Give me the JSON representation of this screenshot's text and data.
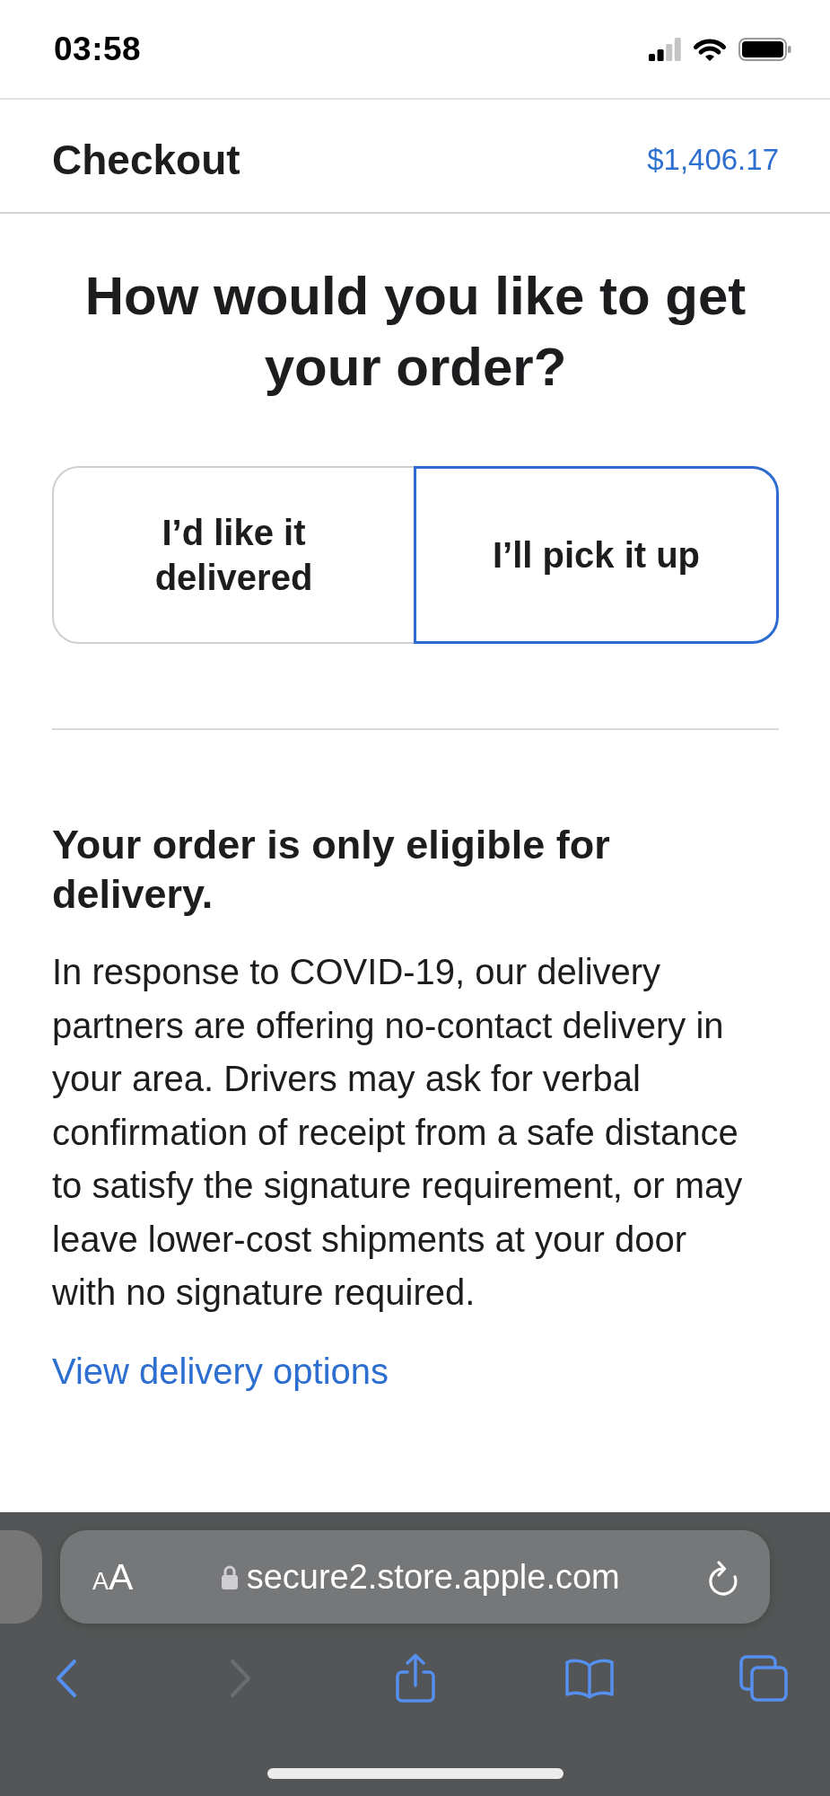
{
  "status_bar": {
    "time": "03:58"
  },
  "header": {
    "title": "Checkout",
    "total": "$1,406.17"
  },
  "heading": "How would you like to get your order?",
  "fulfillment_options": [
    {
      "label": "I’d like it delivered",
      "selected": false
    },
    {
      "label": "I’ll pick it up",
      "selected": true
    }
  ],
  "notice": {
    "title": "Your order is only eligible for delivery.",
    "body": "In response to COVID-19, our delivery partners are offering no-contact delivery in your area. Drivers may ask for verbal confirmation of receipt from a safe distance to satisfy the signature requirement, or may leave lower-cost shipments at your door with no signature required.",
    "link": "View delivery options"
  },
  "browser_toolbar": {
    "text_size_button": "AA",
    "url": "secure2.store.apple.com",
    "nav": [
      {
        "kind": "back",
        "disabled": false
      },
      {
        "kind": "forward",
        "disabled": true
      },
      {
        "kind": "share",
        "disabled": false
      },
      {
        "kind": "bookmarks",
        "disabled": false
      },
      {
        "kind": "tabs",
        "disabled": false
      }
    ]
  }
}
